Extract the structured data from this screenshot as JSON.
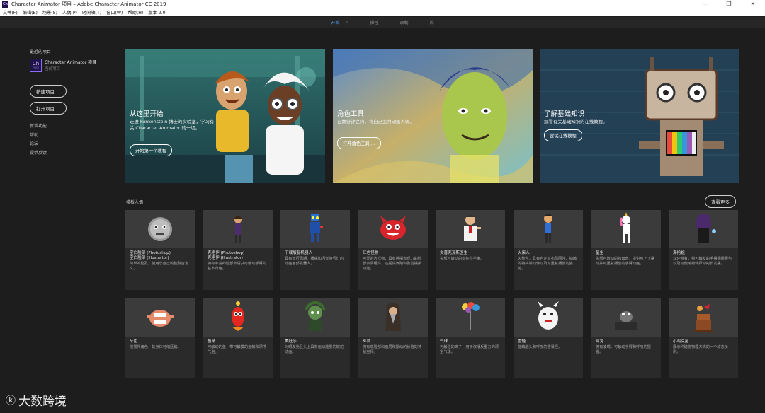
{
  "window": {
    "title": "Character Animator 项目 – Adobe Character Animator CC 2019",
    "app_icon": "Ch",
    "controls": [
      "—",
      "❐",
      "✕"
    ]
  },
  "menu": [
    "文件(F)",
    "编辑(E)",
    "场景(S)",
    "人偶(P)",
    "时间轴(T)",
    "窗口(W)",
    "帮助(H)",
    "版本 2.0"
  ],
  "tabs": [
    {
      "label": "开始",
      "active": true
    },
    {
      "label": "操控",
      "active": false
    },
    {
      "label": "录制",
      "active": false
    },
    {
      "label": "流",
      "active": false
    }
  ],
  "tab_menu_glyph": "≡",
  "sidebar": {
    "recent_title": "最近的项目",
    "recent_item_name": "Character Animator 项目",
    "recent_item_sub": "当前项目",
    "icon_text": "Ch",
    "icon_sub": "PROJ",
    "new_project": "新建项目 ...",
    "open_project": "打开项目 ...",
    "links": [
      "新增功能",
      "帮助",
      "论坛",
      "提供反馈"
    ]
  },
  "heroes": [
    {
      "title": "从这里开始",
      "text": "走进 Funkenstein 博士的实验室，学习有关 Character Animator 的一切。",
      "button": "开始第一个教程"
    },
    {
      "title": "角色工具",
      "text": "在数分钟之内，将自己变为动画人偶。",
      "button": "打开角色工具 ..."
    },
    {
      "title": "了解基础知识",
      "text": "观看有关基础知识的在线教程。",
      "button": "尝试在线教程"
    }
  ],
  "puppets_section": {
    "title": "模板人偶",
    "more_button": "查看更多"
  },
  "puppets_row1": [
    {
      "name": "空白脸部 (Photoshop)\n空白脸部 (Illustrator)",
      "desc": "简单的脸孔，使用您自己的脸融合定义。",
      "icon": "blank-face"
    },
    {
      "name": "克洛伊 (Photoshop)\n克洛伊 (Illustrator)",
      "desc": "拥有丰富的脸部表情并可触动手臂的基本角色。",
      "icon": "chloe"
    },
    {
      "name": "下载版复机器人",
      "desc": "具有步行周期、播嘴和闪光接号灯的动画面部机器人。",
      "icon": "robot"
    },
    {
      "name": "红色怪物",
      "desc": "可爱的吉祥物，具有摇摆表现力的脸部表情组件，还提供舞蹈和警觉摆拨功能。",
      "icon": "red-monster"
    },
    {
      "name": "文普克瓦斯医生",
      "desc": "头部可转动的疯狂科学家。",
      "icon": "doctor"
    },
    {
      "name": "火柴人",
      "desc": "火柴人，具有自定义布局图件、抽搐的特头转动作以及可重复播放的姿势。",
      "icon": "stick-man"
    },
    {
      "name": "星尘",
      "desc": "头部可转动的独角兽，提供可上下摆动并可重复播放的手臂动画。",
      "icon": "unicorn"
    },
    {
      "name": "海拾姐",
      "desc": "双环带有，带可触发的手摆钢帽服与以及可使用物体挥动的长发摆。",
      "icon": "witch"
    }
  ],
  "puppets_row2": [
    {
      "name": "牙齿",
      "desc": "摇摆伴角色，其身体可缩压扁。",
      "icon": "teeth"
    },
    {
      "name": "鱼精",
      "desc": "可触动的鱼，带可触摸的鱼鳍和漂浮气泡。",
      "icon": "fish"
    },
    {
      "name": "美杜莎",
      "desc": "对眼发光且头上具有运动能量的蛇蛇动画。",
      "icon": "medusa"
    },
    {
      "name": "巫师",
      "desc": "拥有嘴脸部和面层和摆动的长袍的神秘巫师。",
      "icon": "wizard"
    },
    {
      "name": "气球",
      "desc": "可触碰的离子，用于演播反重力的漂空气球。",
      "icon": "balloons"
    },
    {
      "name": "雪怪",
      "desc": "能触脑头和呼吸的雪暴怪。",
      "icon": "yeti"
    },
    {
      "name": "阿戈",
      "desc": "拥有凌嘴，可触动手臂和呼吸的猩猩。",
      "icon": "gorilla"
    },
    {
      "name": "小鸡克星",
      "desc": "展示种建施物理方式的一个动态示例。",
      "icon": "chicken"
    }
  ],
  "watermark": {
    "logo": "ⓚ",
    "text": "大数跨境"
  }
}
